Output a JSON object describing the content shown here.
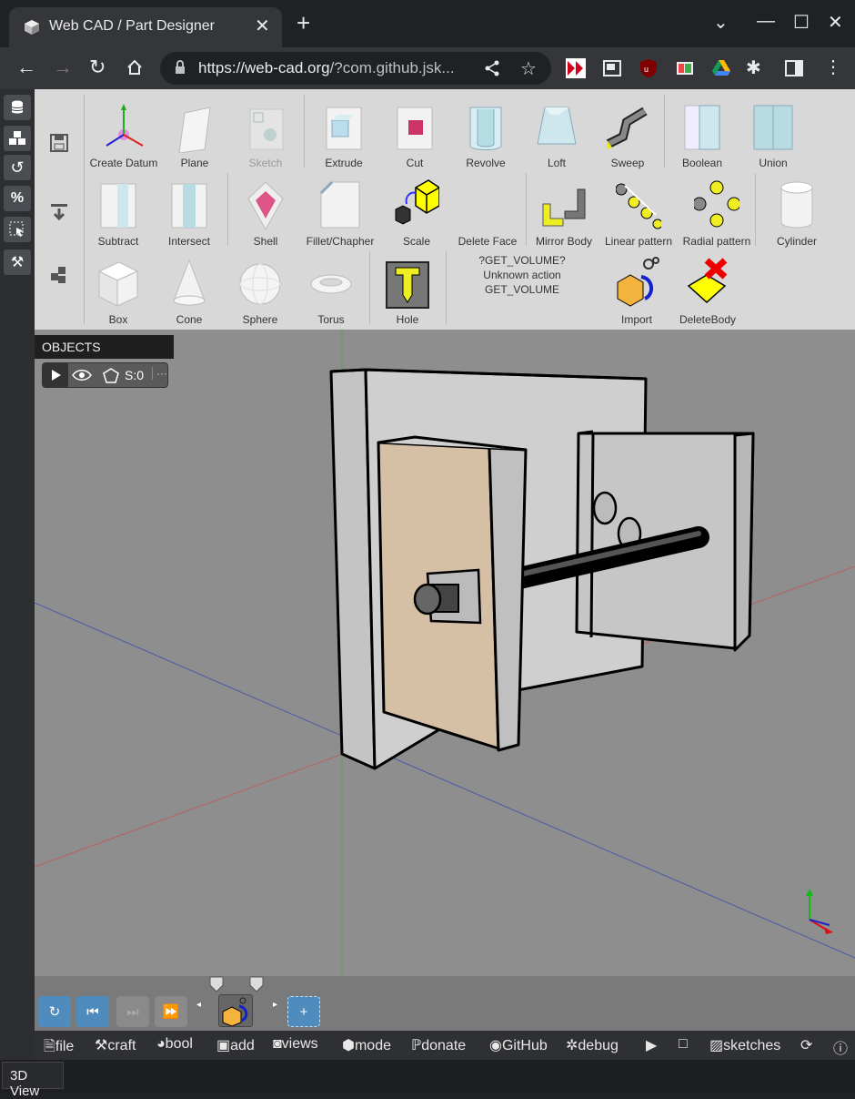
{
  "browser": {
    "tab_title": "Web CAD / Part Designer",
    "url_host": "https://web-cad.org",
    "url_rest": "/?com.github.jsk...",
    "new_tab": "+",
    "close": "✕"
  },
  "toolbar": {
    "row1": [
      "Create Datum",
      "Plane",
      "Sketch",
      "Extrude",
      "Cut",
      "Revolve",
      "Loft",
      "Sweep",
      "Boolean",
      "Union"
    ],
    "row2": [
      "Subtract",
      "Intersect",
      "Shell",
      "Fillet/Chapher",
      "Scale",
      "Delete Face",
      "Mirror Body",
      "Linear pattern",
      "Radial pattern",
      "Cylinder"
    ],
    "row3": [
      "Box",
      "Cone",
      "Sphere",
      "Torus",
      "Hole",
      "Import",
      "DeleteBody"
    ],
    "volume_line1": "?GET_VOLUME?",
    "volume_line2": "Unknown action GET_VOLUME"
  },
  "objects": {
    "header": "OBJECTS",
    "shape_count": "S:0",
    "more": "···"
  },
  "menubar": {
    "file": "file",
    "craft": "craft",
    "bool": "bool",
    "add": "add",
    "views": "views",
    "mode": "mode",
    "donate": "donate",
    "github": "GitHub",
    "debug": "debug",
    "sketches": "sketches"
  },
  "status": {
    "tab": "3D View"
  },
  "colors": {
    "accent": "#4f8bbd",
    "panel": "#d8d8d8",
    "viewport": "#8e8e8e",
    "face_highlight": "#d5c0a6"
  }
}
